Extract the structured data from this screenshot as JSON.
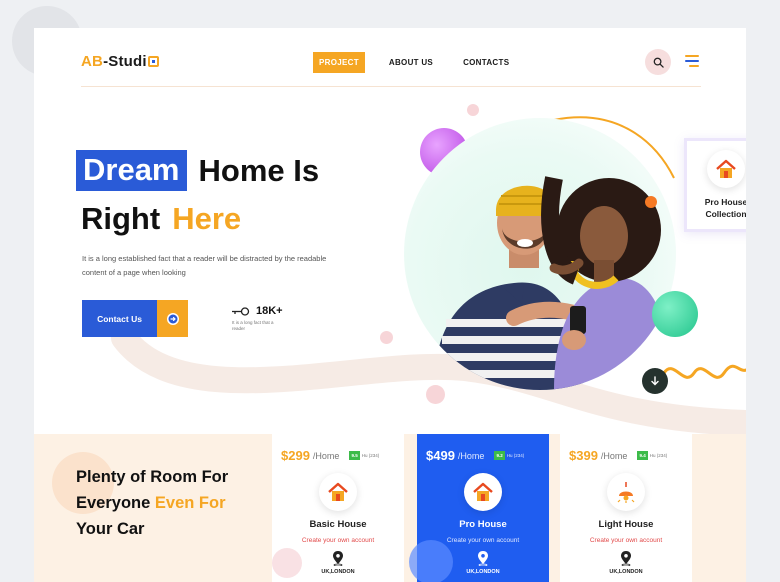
{
  "brand": {
    "prefix": "AB",
    "name": "-Studi"
  },
  "nav": {
    "items": [
      "PROJECT",
      "ABOUT US",
      "CONTACTS"
    ]
  },
  "hero": {
    "title_highlight": "Dream",
    "title_rest": "Home Is",
    "title_line2": "Right",
    "title_accent": "Here",
    "description": "It is a long established fact that a reader will be distracted by the readable content of a page when looking",
    "cta_label": "Contact Us",
    "stat_value": "18K+",
    "stat_caption": "It is a long fact that a reader"
  },
  "pro_card": {
    "title_line1": "Pro House",
    "title_line2": "Collection"
  },
  "section": {
    "title_line1": "Plenty of Room For",
    "title_line2_start": "Everyone",
    "title_line2_accent": "Even For",
    "title_line3": "Your Car"
  },
  "pricing": [
    {
      "price": "$299",
      "unit": "/Home",
      "score": "9.5",
      "reviews": "Hu (234)",
      "name": "Basic House",
      "subtitle": "Create your own  account",
      "location": "UK,LONDON"
    },
    {
      "price": "$499",
      "unit": "/Home",
      "score": "9.2",
      "reviews": "Hu (234)",
      "name": "Pro House",
      "subtitle": "Create your own  account",
      "location": "UK,LONDON"
    },
    {
      "price": "$399",
      "unit": "/Home",
      "score": "9.4",
      "reviews": "Hu (234)",
      "name": "Light House",
      "subtitle": "Create your own  account",
      "location": "UK,LONDON"
    }
  ],
  "colors": {
    "accent": "#f5a623",
    "primary": "#2a5bd7",
    "featured": "#1f5df0",
    "rating": "#3dbb4a"
  },
  "icons": [
    "search-icon",
    "menu-icon",
    "arrow-right-circle-icon",
    "key-icon",
    "arrow-down-icon",
    "house-icon",
    "lamp-icon",
    "location-pin-icon"
  ]
}
